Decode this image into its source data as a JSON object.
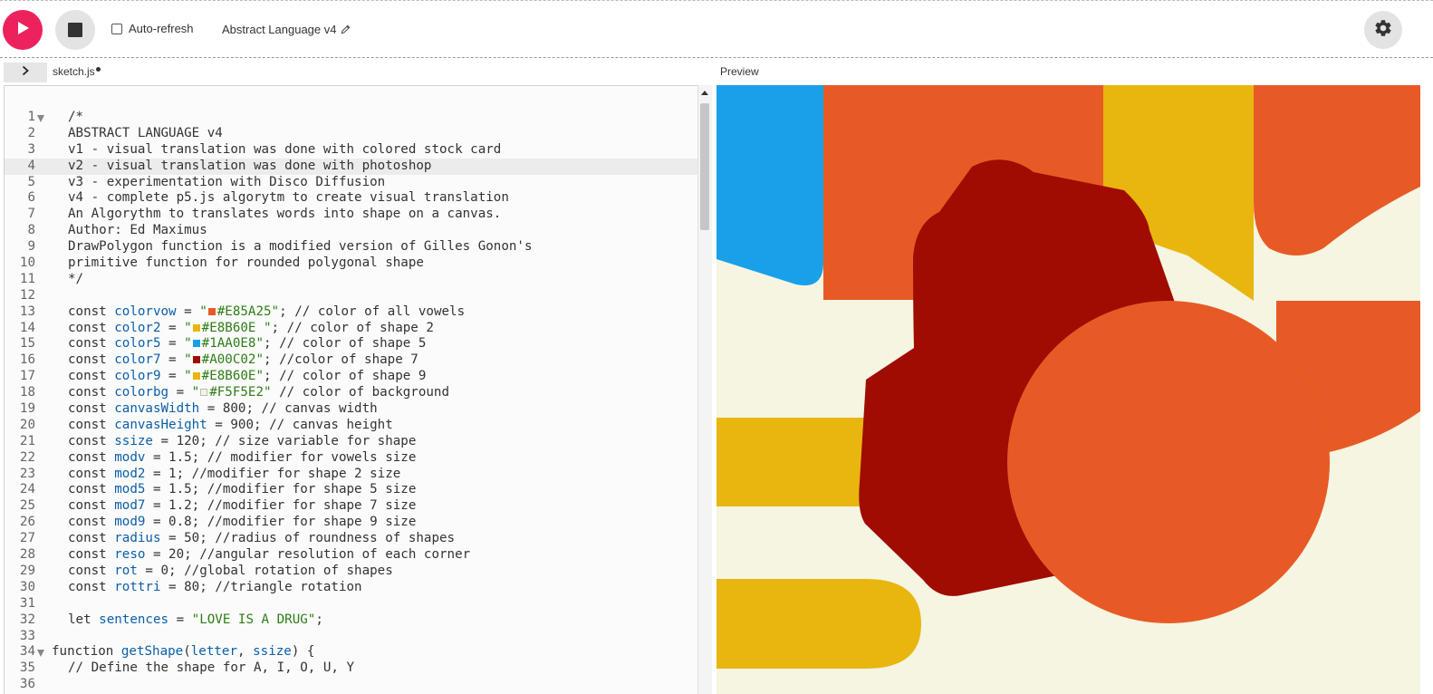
{
  "toolbar": {
    "autorefresh_label": "Auto-refresh",
    "project_name": "Abstract Language v4"
  },
  "tabs": {
    "file_name": "sketch.js",
    "preview_label": "Preview"
  },
  "colors": {
    "play": "#ED225D",
    "vowel": "#E85A25",
    "shape2": "#E8B60E",
    "shape5": "#1AA0E8",
    "shape7": "#A00C02",
    "background": "#F5F5E2"
  },
  "icons": [
    "play-icon",
    "stop-icon",
    "pencil-icon",
    "gear-icon",
    "chevron-right-icon"
  ],
  "editor": {
    "active_line": 4,
    "lines": [
      {
        "n": "1",
        "fold": true,
        "indent": true,
        "segs": [
          [
            "t",
            "/*"
          ]
        ]
      },
      {
        "n": "2",
        "indent": true,
        "segs": [
          [
            "t",
            "ABSTRACT LANGUAGE v4"
          ]
        ]
      },
      {
        "n": "3",
        "indent": true,
        "segs": [
          [
            "t",
            "v1 - visual translation was done with colored stock card"
          ]
        ]
      },
      {
        "n": "4",
        "indent": true,
        "segs": [
          [
            "t",
            "v2 - visual translation was done with photoshop"
          ]
        ]
      },
      {
        "n": "5",
        "indent": true,
        "segs": [
          [
            "t",
            "v3 - experimentation with Disco Diffusion"
          ]
        ]
      },
      {
        "n": "6",
        "indent": true,
        "segs": [
          [
            "t",
            "v4 - complete p5.js algorytm to create visual translation"
          ]
        ]
      },
      {
        "n": "7",
        "indent": true,
        "segs": [
          [
            "t",
            "An Algorythm to translates words into shape on a canvas."
          ]
        ]
      },
      {
        "n": "8",
        "indent": true,
        "segs": [
          [
            "t",
            "Author: Ed Maximus"
          ]
        ]
      },
      {
        "n": "9",
        "indent": true,
        "segs": [
          [
            "t",
            "DrawPolygon function is a modified version of Gilles Gonon's"
          ]
        ]
      },
      {
        "n": "10",
        "indent": true,
        "segs": [
          [
            "t",
            "primitive function for rounded polygonal shape"
          ]
        ]
      },
      {
        "n": "11",
        "indent": true,
        "segs": [
          [
            "t",
            "*/"
          ]
        ]
      },
      {
        "n": "12",
        "indent": true,
        "segs": []
      },
      {
        "n": "13",
        "indent": true,
        "segs": [
          [
            "t",
            "const "
          ],
          [
            "id",
            "colorvow"
          ],
          [
            "t",
            " = "
          ],
          [
            "s",
            "\""
          ],
          [
            "sw",
            "#E85A25"
          ],
          [
            "s",
            "#E85A25\""
          ],
          [
            "t",
            "; // color of all vowels"
          ]
        ]
      },
      {
        "n": "14",
        "indent": true,
        "segs": [
          [
            "t",
            "const "
          ],
          [
            "id",
            "color2"
          ],
          [
            "t",
            " = "
          ],
          [
            "s",
            "\""
          ],
          [
            "sw",
            "#E8B60E"
          ],
          [
            "s",
            "#E8B60E \""
          ],
          [
            "t",
            "; // color of shape 2"
          ]
        ]
      },
      {
        "n": "15",
        "indent": true,
        "segs": [
          [
            "t",
            "const "
          ],
          [
            "id",
            "color5"
          ],
          [
            "t",
            " = "
          ],
          [
            "s",
            "\""
          ],
          [
            "sw",
            "#1AA0E8"
          ],
          [
            "s",
            "#1AA0E8\""
          ],
          [
            "t",
            "; // color of shape 5"
          ]
        ]
      },
      {
        "n": "16",
        "indent": true,
        "segs": [
          [
            "t",
            "const "
          ],
          [
            "id",
            "color7"
          ],
          [
            "t",
            " = "
          ],
          [
            "s",
            "\""
          ],
          [
            "sw",
            "#A00C02"
          ],
          [
            "s",
            "#A00C02\""
          ],
          [
            "t",
            "; //color of shape 7"
          ]
        ]
      },
      {
        "n": "17",
        "indent": true,
        "segs": [
          [
            "t",
            "const "
          ],
          [
            "id",
            "color9"
          ],
          [
            "t",
            " = "
          ],
          [
            "s",
            "\""
          ],
          [
            "sw",
            "#E8B60E"
          ],
          [
            "s",
            "#E8B60E\""
          ],
          [
            "t",
            "; // color of shape 9"
          ]
        ]
      },
      {
        "n": "18",
        "indent": true,
        "segs": [
          [
            "t",
            "const "
          ],
          [
            "id",
            "colorbg"
          ],
          [
            "t",
            " = "
          ],
          [
            "s",
            "\""
          ],
          [
            "sw",
            "#F5F5E2"
          ],
          [
            "s",
            "#F5F5E2\""
          ],
          [
            "t",
            " // color of background"
          ]
        ]
      },
      {
        "n": "19",
        "indent": true,
        "segs": [
          [
            "t",
            "const "
          ],
          [
            "id",
            "canvasWidth"
          ],
          [
            "t",
            " = 800; // canvas width"
          ]
        ]
      },
      {
        "n": "20",
        "indent": true,
        "segs": [
          [
            "t",
            "const "
          ],
          [
            "id",
            "canvasHeight"
          ],
          [
            "t",
            " = 900; // canvas height"
          ]
        ]
      },
      {
        "n": "21",
        "indent": true,
        "segs": [
          [
            "t",
            "const "
          ],
          [
            "id",
            "ssize"
          ],
          [
            "t",
            " = 120; // size variable for shape"
          ]
        ]
      },
      {
        "n": "22",
        "indent": true,
        "segs": [
          [
            "t",
            "const "
          ],
          [
            "id",
            "modv"
          ],
          [
            "t",
            " = 1.5; // modifier for vowels size"
          ]
        ]
      },
      {
        "n": "23",
        "indent": true,
        "segs": [
          [
            "t",
            "const "
          ],
          [
            "id",
            "mod2"
          ],
          [
            "t",
            " = 1; //modifier for shape 2 size"
          ]
        ]
      },
      {
        "n": "24",
        "indent": true,
        "segs": [
          [
            "t",
            "const "
          ],
          [
            "id",
            "mod5"
          ],
          [
            "t",
            " = 1.5; //modifier for shape 5 size"
          ]
        ]
      },
      {
        "n": "25",
        "indent": true,
        "segs": [
          [
            "t",
            "const "
          ],
          [
            "id",
            "mod7"
          ],
          [
            "t",
            " = 1.2; //modifier for shape 7 size"
          ]
        ]
      },
      {
        "n": "26",
        "indent": true,
        "segs": [
          [
            "t",
            "const "
          ],
          [
            "id",
            "mod9"
          ],
          [
            "t",
            " = 0.8; //modifier for shape 9 size"
          ]
        ]
      },
      {
        "n": "27",
        "indent": true,
        "segs": [
          [
            "t",
            "const "
          ],
          [
            "id",
            "radius"
          ],
          [
            "t",
            " = 50; //radius of roundness of shapes"
          ]
        ]
      },
      {
        "n": "28",
        "indent": true,
        "segs": [
          [
            "t",
            "const "
          ],
          [
            "id",
            "reso"
          ],
          [
            "t",
            " = 20; //angular resolution of each corner"
          ]
        ]
      },
      {
        "n": "29",
        "indent": true,
        "segs": [
          [
            "t",
            "const "
          ],
          [
            "id",
            "rot"
          ],
          [
            "t",
            " = 0; //global rotation of shapes"
          ]
        ]
      },
      {
        "n": "30",
        "indent": true,
        "segs": [
          [
            "t",
            "const "
          ],
          [
            "id",
            "rottri"
          ],
          [
            "t",
            " = 80; //triangle rotation"
          ]
        ]
      },
      {
        "n": "31",
        "indent": true,
        "segs": []
      },
      {
        "n": "32",
        "indent": true,
        "segs": [
          [
            "t",
            "let "
          ],
          [
            "id",
            "sentences"
          ],
          [
            "t",
            " = "
          ],
          [
            "s",
            "\"LOVE IS A DRUG\""
          ],
          [
            "t",
            ";"
          ]
        ]
      },
      {
        "n": "33",
        "indent": true,
        "segs": []
      },
      {
        "n": "34",
        "fold": true,
        "indent": false,
        "segs": [
          [
            "t",
            "function "
          ],
          [
            "id",
            "getShape"
          ],
          [
            "t",
            "("
          ],
          [
            "id",
            "letter"
          ],
          [
            "t",
            ", "
          ],
          [
            "id",
            "ssize"
          ],
          [
            "t",
            ") {"
          ]
        ]
      },
      {
        "n": "35",
        "indent": true,
        "segs": [
          [
            "t",
            "// Define the shape for A, I, O, U, Y"
          ]
        ]
      },
      {
        "n": "36",
        "indent": true,
        "segs": []
      }
    ]
  }
}
